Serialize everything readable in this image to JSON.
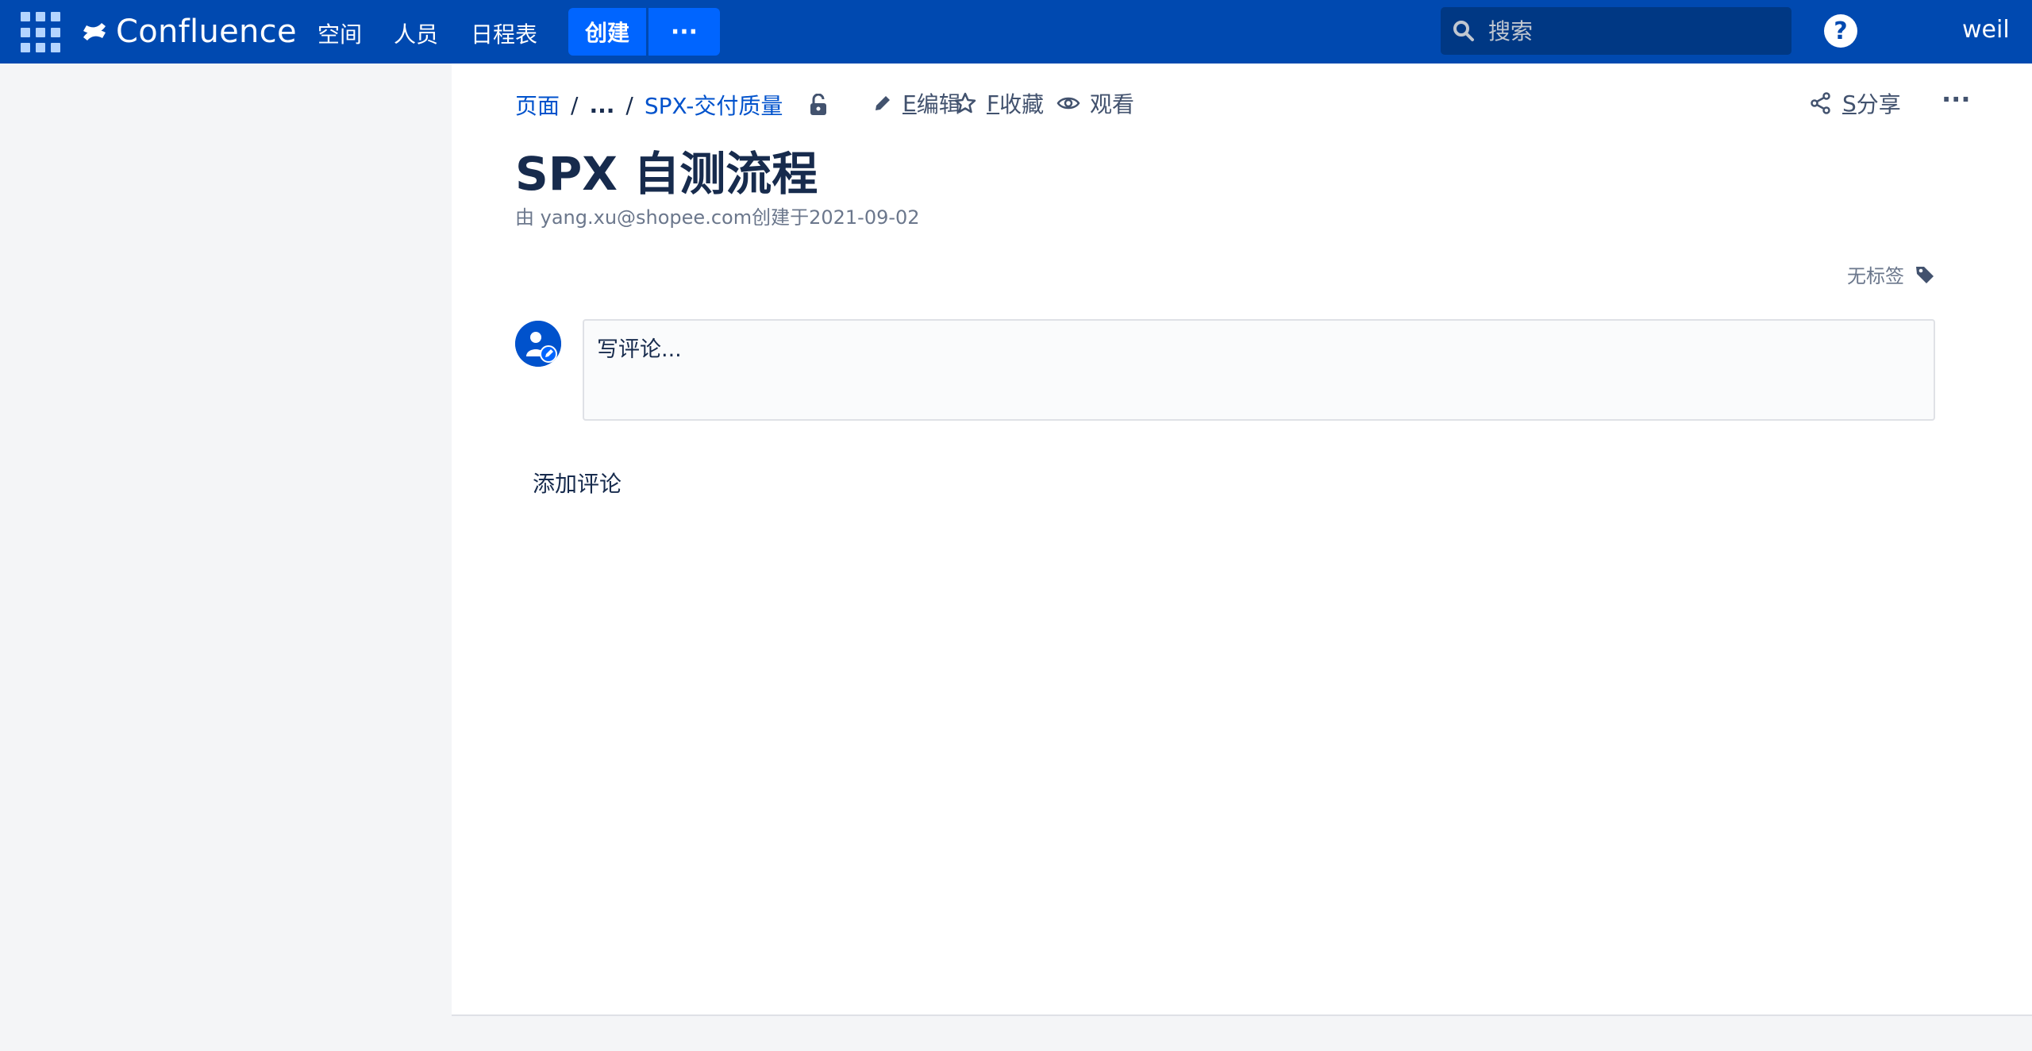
{
  "topnav": {
    "logo": "Confluence",
    "links": [
      "空间",
      "人员",
      "日程表"
    ],
    "create_label": "创建",
    "more_label": "···",
    "search_placeholder": "搜索",
    "help_label": "?",
    "user": "weil"
  },
  "breadcrumb": {
    "root": "页面",
    "sep": "/",
    "ellipsis": "...",
    "parent": "SPX-交付质量"
  },
  "actions": {
    "edit_key": "E",
    "edit": "编辑",
    "fav_key": "F",
    "fav": "收藏",
    "watch": "观看",
    "share_key": "S",
    "share": "分享",
    "more": "···"
  },
  "page": {
    "title": "SPX 自测流程",
    "byline": "由 yang.xu@shopee.com创建于2021-09-02",
    "labels": "无标签"
  },
  "comments": {
    "placeholder": "写评论...",
    "add": "添加评论"
  },
  "colors": {
    "nav_bg": "#0049b0",
    "button": "#0065ff",
    "link": "#0052cc",
    "text": "#172b4d"
  }
}
